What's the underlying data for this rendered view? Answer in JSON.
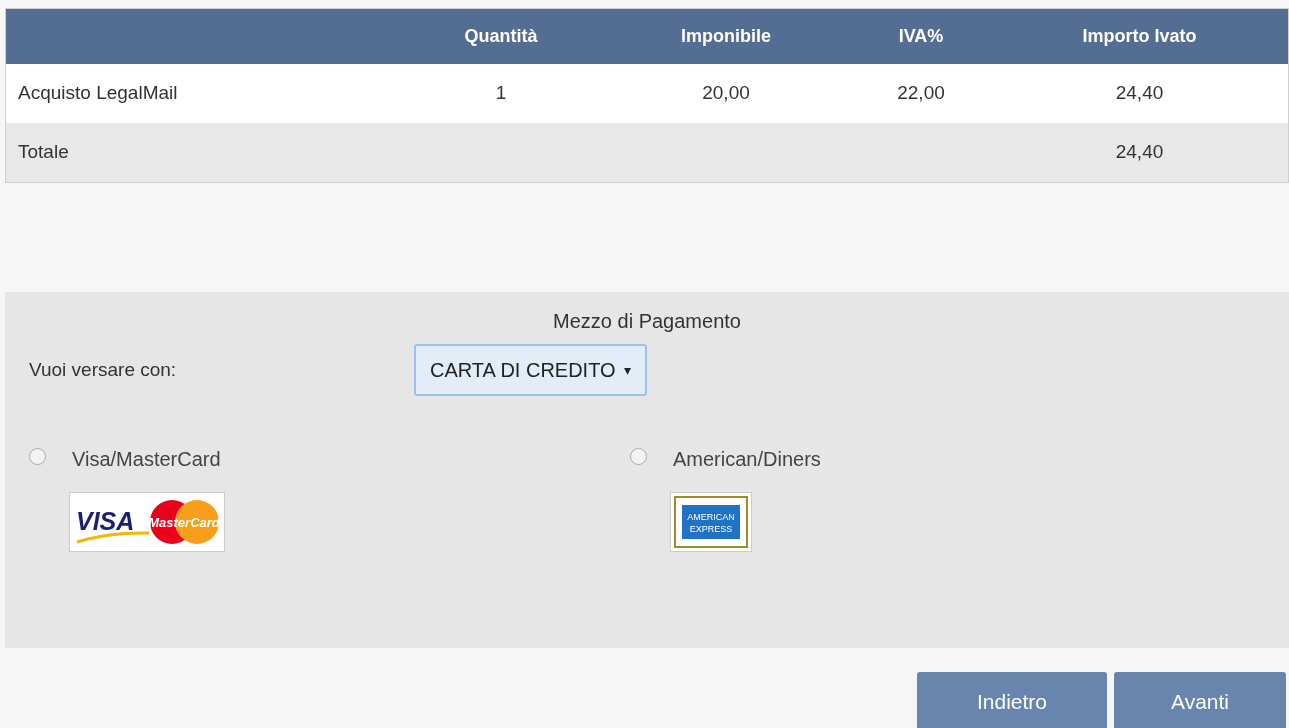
{
  "table": {
    "columns": [
      "",
      "Quantità",
      "Imponibile",
      "IVA%",
      "Importo Ivato"
    ],
    "rows": [
      {
        "kind": "item",
        "cells": [
          "Acquisto LegalMail",
          "1",
          "20,00",
          "22,00",
          "24,40"
        ]
      },
      {
        "kind": "total",
        "cells": [
          "Totale",
          "",
          "",
          "",
          "24,40"
        ]
      }
    ]
  },
  "payment": {
    "title": "Mezzo di Pagamento",
    "prompt": "Vuoi versare con:",
    "method": {
      "value": "CARTA DI CREDITO",
      "arrow": "▾"
    },
    "options": [
      {
        "label": "Visa/MasterCard",
        "selected": false,
        "kind": "visa_mastercard",
        "logo_text": [
          "VISA",
          "MasterCard"
        ]
      },
      {
        "label": "American/Diners",
        "selected": false,
        "kind": "amex",
        "logo_text": [
          "AMERICAN",
          "EXPRESS"
        ]
      }
    ]
  },
  "buttons": [
    "Indietro",
    "Avanti"
  ]
}
